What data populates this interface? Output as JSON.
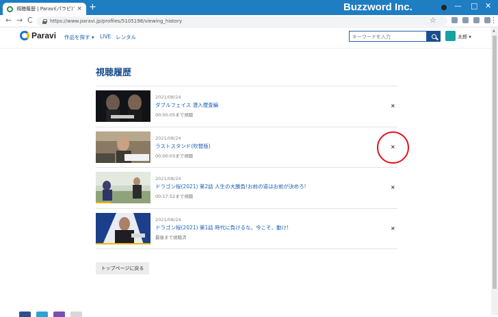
{
  "browser": {
    "tab_title": "視聴履歴 | Paravi(パラビ)で見る",
    "tab_close": "×",
    "new_tab": "+",
    "brand": "Buzzword Inc.",
    "url": "https://www.paravi.jp/profiles/5105198/viewing_history",
    "back": "←",
    "forward": "→",
    "reload": "C",
    "star": "☆",
    "menu": "⋮",
    "minimize": "—",
    "maximize": "□",
    "close": "✕"
  },
  "site": {
    "logo": "Paravi",
    "nav": {
      "genres": "作品を探す ▾",
      "live": "LIVE",
      "rental": "レンタル"
    },
    "search_placeholder": "キーワードを入力",
    "user_name": "太郎 ▾"
  },
  "page": {
    "title": "視聴履歴",
    "back_button": "トップページに戻る"
  },
  "history": [
    {
      "date": "2021/08/24",
      "title": "ダブルフェイス 潜入捜査編",
      "status": "00:00:05まで視聴",
      "progress": 0.0
    },
    {
      "date": "2021/08/24",
      "title": "ラストスタンド(吹替版)",
      "status": "00:00:03まで視聴",
      "progress": 0.0
    },
    {
      "date": "2021/08/24",
      "title": "ドラゴン桜(2021) 第2話 人生の大勝負!お前の道はお前が決めろ!",
      "status": "00:17:52まで視聴",
      "progress": 0.28
    },
    {
      "date": "2021/08/24",
      "title": "ドラゴン桜(2021) 第1話 時代に負けるな。今こそ、動け!",
      "status": "最後まで視聴済",
      "progress": 1.0
    }
  ],
  "delete_label": "×",
  "colors": {
    "chrome_blue": "#1f7dc2",
    "link_blue": "#1a5fb4",
    "title_navy": "#1a4f8e",
    "progress_gold": "#f0b400",
    "annotation_red": "#e0141e"
  }
}
